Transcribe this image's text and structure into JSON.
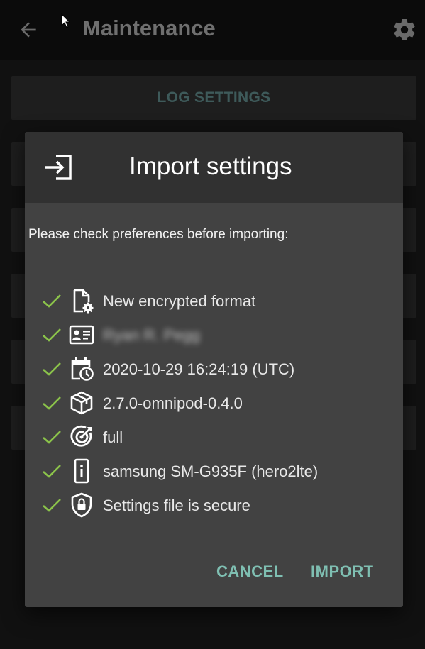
{
  "appbar": {
    "title": "Maintenance",
    "back_icon": "arrow-left-icon",
    "settings_icon": "gear-icon"
  },
  "background": {
    "buttons": [
      "LOG SETTINGS",
      "",
      "",
      "",
      "",
      ""
    ]
  },
  "dialog": {
    "title": "Import settings",
    "title_icon": "import-icon",
    "prompt": "Please check preferences before importing:",
    "items": [
      {
        "icon": "file-cog-icon",
        "text": "New encrypted format"
      },
      {
        "icon": "id-card-icon",
        "text": "Ryan R. Pegg"
      },
      {
        "icon": "calendar-clock-icon",
        "text": "2020-10-29 16:24:19 (UTC)"
      },
      {
        "icon": "package-icon",
        "text": "2.7.0-omnipod-0.4.0"
      },
      {
        "icon": "target-icon",
        "text": "full"
      },
      {
        "icon": "phone-info-icon",
        "text": "samsung SM-G935F (hero2lte)"
      },
      {
        "icon": "shield-lock-icon",
        "text": "Settings file is secure"
      }
    ],
    "cancel_label": "CANCEL",
    "import_label": "IMPORT"
  },
  "colors": {
    "accent": "#7fbfb2",
    "check": "#8bc34a",
    "dialog_bg": "#424242",
    "dialog_header_bg": "#313131"
  }
}
